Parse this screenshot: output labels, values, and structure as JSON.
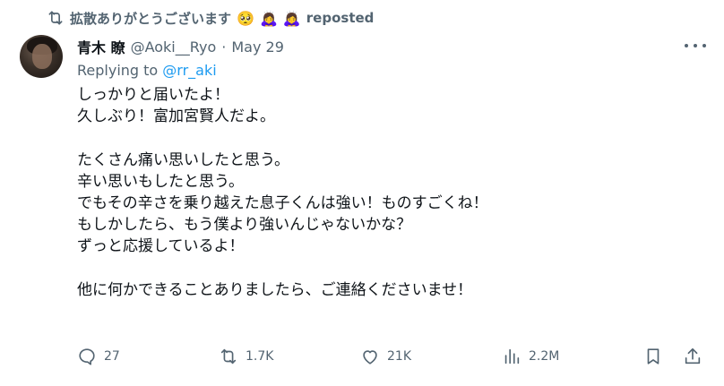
{
  "repost": {
    "text": "拡散ありがとうございます",
    "emojis": [
      "🥺",
      "🙇‍♀️",
      "🙇‍♀️"
    ],
    "suffix": "reposted"
  },
  "author": {
    "display_name": "青木 瞭",
    "handle": "@Aoki__Ryo",
    "separator": "·",
    "date": "May 29"
  },
  "reply": {
    "prefix": "Replying to",
    "mention": "@rr_aki"
  },
  "body": [
    "しっかりと届いたよ！",
    "久しぶり！富加宮賢人だよ。",
    "",
    "たくさん痛い思いしたと思う。",
    "辛い思いもしたと思う。",
    "でもその辛さを乗り越えた息子くんは強い！ものすごくね！",
    "もしかしたら、もう僕より強いんじゃないかな？",
    "ずっと応援しているよ！",
    "",
    "他に何かできることありましたら、ご連絡くださいませ！"
  ],
  "actions": {
    "replies": "27",
    "reposts": "1.7K",
    "likes": "21K",
    "views": "2.2M"
  },
  "icons": {
    "repost": "repost-icon",
    "reply": "comment-icon",
    "like": "heart-icon",
    "views": "bar-chart-icon",
    "bookmark": "bookmark-icon",
    "share": "share-icon",
    "more": "more-icon"
  },
  "colors": {
    "text": "#0f1419",
    "secondary": "#536471",
    "link": "#1d9bf0"
  }
}
